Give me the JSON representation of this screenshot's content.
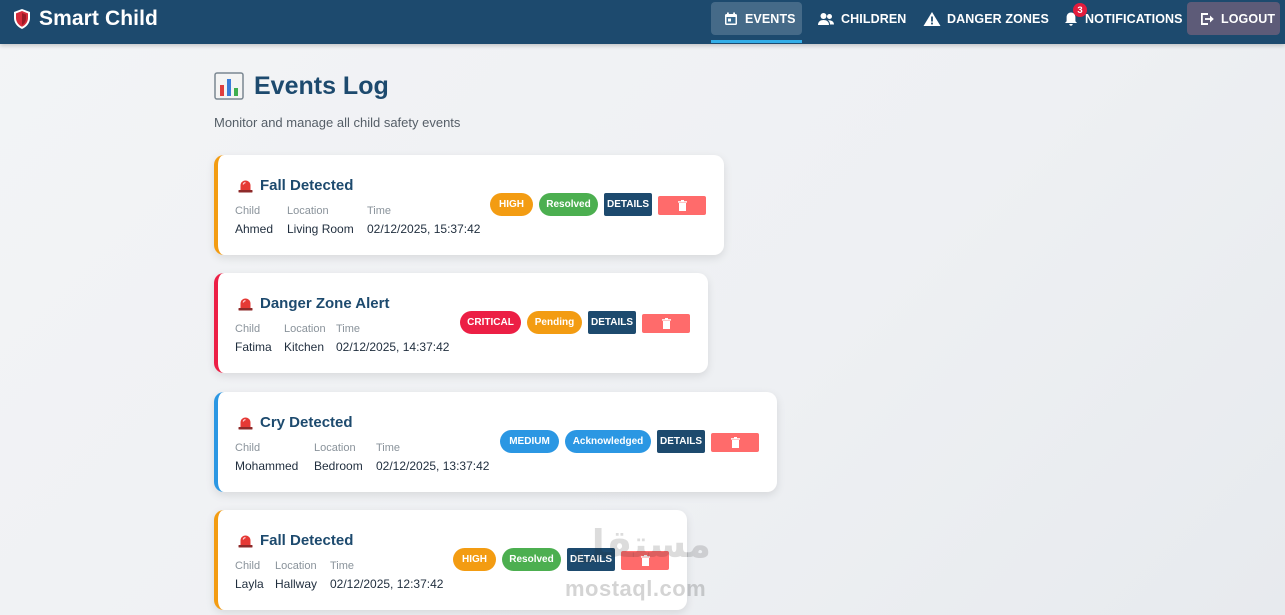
{
  "app": {
    "name": "Smart Child"
  },
  "nav": {
    "events": "EVENTS",
    "children": "CHILDREN",
    "danger_zones": "DANGER ZONES",
    "notifications": "NOTIFICATIONS",
    "notifications_count": "3",
    "logout": "LOGOUT",
    "active": "events"
  },
  "page": {
    "title": "Events Log",
    "subtitle": "Monitor and manage all child safety events"
  },
  "labels": {
    "child": "Child",
    "location": "Location",
    "time": "Time",
    "details": "DETAILS"
  },
  "events": [
    {
      "title": "Fall Detected",
      "child": "Ahmed",
      "location": "Living Room",
      "time": "02/12/2025, 15:37:42",
      "severity": "HIGH",
      "status": "Resolved",
      "accent": "#f39c12"
    },
    {
      "title": "Danger Zone Alert",
      "child": "Fatima",
      "location": "Kitchen",
      "time": "02/12/2025, 14:37:42",
      "severity": "CRITICAL",
      "status": "Pending",
      "accent": "#ec1f45"
    },
    {
      "title": "Cry Detected",
      "child": "Mohammed",
      "location": "Bedroom",
      "time": "02/12/2025, 13:37:42",
      "severity": "MEDIUM",
      "status": "Acknowledged",
      "accent": "#2b97e3"
    },
    {
      "title": "Fall Detected",
      "child": "Layla",
      "location": "Hallway",
      "time": "02/12/2025, 12:37:42",
      "severity": "HIGH",
      "status": "Resolved",
      "accent": "#f39c12"
    }
  ],
  "icons": {
    "brand": "shield-icon",
    "events": "calendar-icon",
    "children": "people-icon",
    "danger_zones": "warning-icon",
    "notifications": "bell-icon",
    "logout": "logout-icon",
    "title": "bar-chart-icon",
    "event": "siren-icon",
    "delete": "trash-icon"
  },
  "colors": {
    "navbar": "#1d4a6e",
    "high": "#f39c12",
    "critical": "#ec1f45",
    "medium": "#2b97e3",
    "resolved": "#4caf50",
    "pending": "#f39c12",
    "acknowledged": "#2b97e3",
    "delete": "#ff6b6b"
  },
  "watermark": {
    "arabic": "مستقل",
    "latin": "mostaql.com"
  }
}
